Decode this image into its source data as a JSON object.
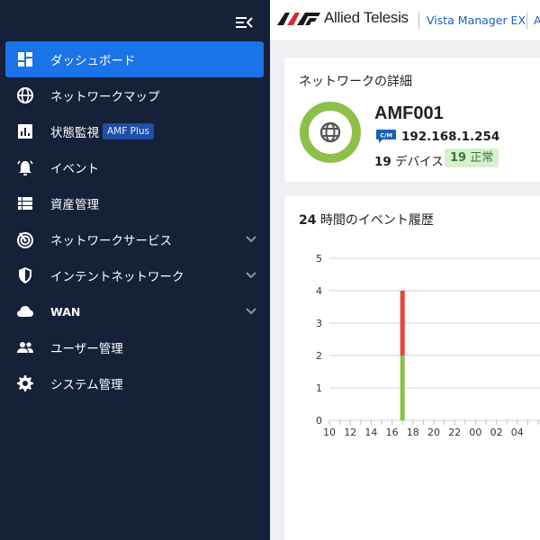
{
  "header": {
    "brand": "Allied Telesis",
    "links": [
      "Vista Manager EX",
      "A"
    ]
  },
  "sidebar": {
    "items": [
      {
        "label": "ダッシュボード",
        "icon": "dashboard-icon",
        "active": true
      },
      {
        "label": "ネットワークマップ",
        "icon": "globe-icon"
      },
      {
        "label": "状態監視",
        "icon": "bar-chart-icon",
        "badge": "AMF Plus"
      },
      {
        "label": "イベント",
        "icon": "alarm-icon"
      },
      {
        "label": "資産管理",
        "icon": "list-icon"
      },
      {
        "label": "ネットワークサービス",
        "icon": "radar-icon",
        "expandable": true
      },
      {
        "label": "インテントネットワーク",
        "icon": "shield-icon",
        "expandable": true
      },
      {
        "label": "WAN",
        "icon": "cloud-icon",
        "expandable": true
      },
      {
        "label": "ユーザー管理",
        "icon": "users-icon"
      },
      {
        "label": "システム管理",
        "icon": "gear-icon"
      }
    ]
  },
  "network_card": {
    "title": "ネットワークの詳細",
    "device_name": "AMF001",
    "role_badge": "C/M",
    "ip": "192.168.1.254",
    "device_count": "19",
    "device_label": "デバイス",
    "ok_count": "19",
    "ok_label": "正常"
  },
  "history_card": {
    "title_num": "24",
    "title_text": "時間のイベント履歴"
  },
  "colors": {
    "sidebar_bg": "#152039",
    "active": "#1a73e8",
    "ok_green": "#8cc04b",
    "error_red": "#e8443a"
  },
  "chart_data": {
    "type": "bar",
    "stacked": true,
    "categories": [
      "10",
      "12",
      "14",
      "16",
      "18",
      "20",
      "22",
      "00",
      "02",
      "04"
    ],
    "ylim": [
      0,
      5
    ],
    "yticks": [
      0,
      1,
      2,
      3,
      4,
      5
    ],
    "series": [
      {
        "color": "#8cc04b",
        "points": [
          {
            "x": 17,
            "y": 2
          }
        ]
      },
      {
        "color": "#e8443a",
        "points": [
          {
            "x": 17,
            "y": 2
          }
        ]
      }
    ]
  }
}
